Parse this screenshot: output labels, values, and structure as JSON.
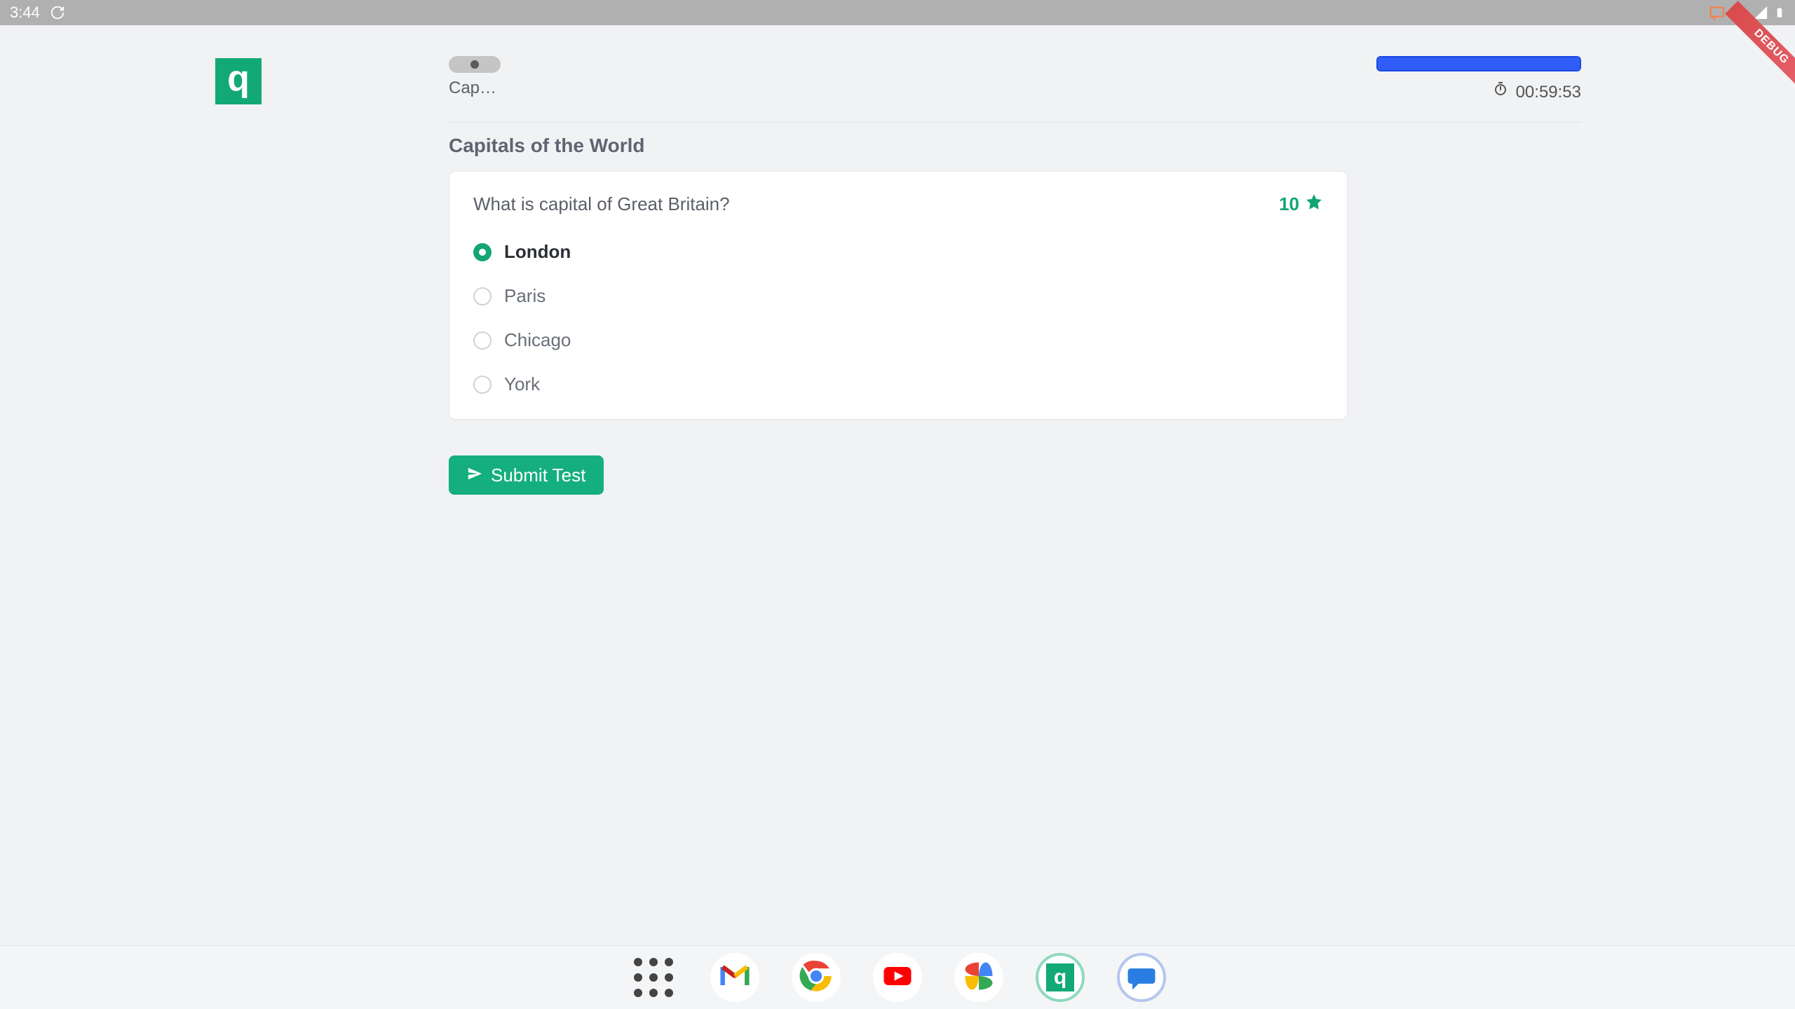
{
  "status_bar": {
    "time": "3:44",
    "debug_label": "DEBUG"
  },
  "header": {
    "logo_letter": "q",
    "breadcrumb_short": "Capitals of the World",
    "timer": "00:59:53"
  },
  "test": {
    "title": "Capitals of the World",
    "question": "What is capital of Great Britain?",
    "points": "10",
    "options": [
      {
        "label": "London",
        "selected": true
      },
      {
        "label": "Paris",
        "selected": false
      },
      {
        "label": "Chicago",
        "selected": false
      },
      {
        "label": "York",
        "selected": false
      }
    ],
    "submit_label": "Submit Test"
  },
  "dock": {
    "items": [
      {
        "slug": "app-drawer"
      },
      {
        "slug": "gmail"
      },
      {
        "slug": "chrome"
      },
      {
        "slug": "youtube"
      },
      {
        "slug": "photos"
      },
      {
        "slug": "quiz-app"
      },
      {
        "slug": "messages"
      }
    ]
  }
}
